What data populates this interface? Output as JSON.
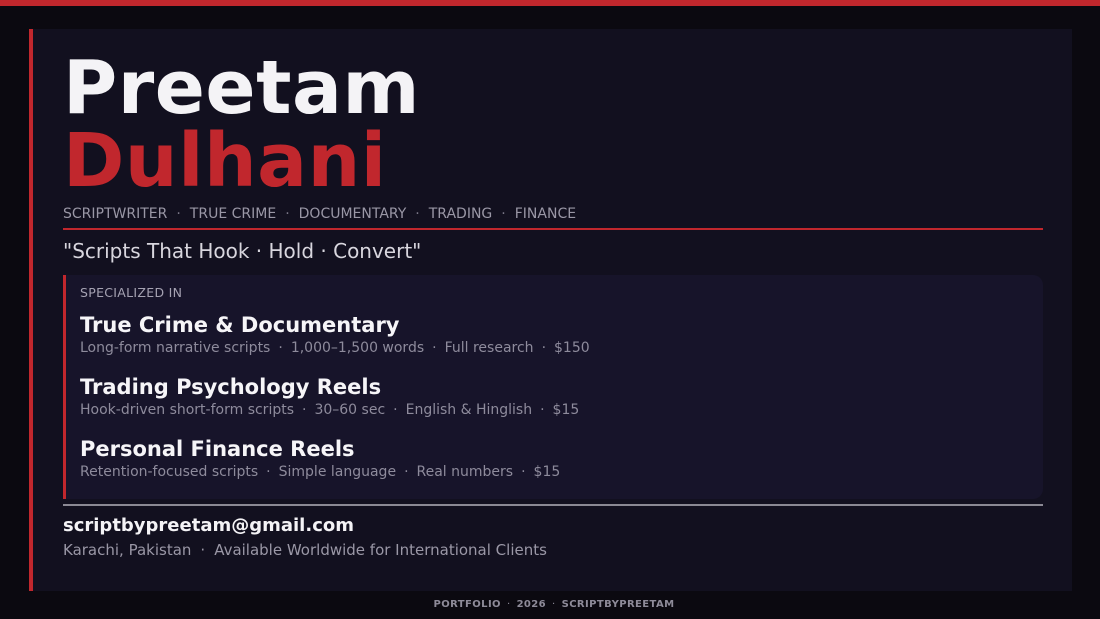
{
  "profile": {
    "first_name": "Preetam",
    "last_name": "Dulhani",
    "roles": [
      "SCRIPTWRITER",
      "TRUE CRIME",
      "DOCUMENTARY",
      "TRADING",
      "FINANCE"
    ],
    "tagline": "\"Scripts That Hook · Hold · Convert\""
  },
  "specialized": {
    "heading": "SPECIALIZED IN",
    "services": [
      {
        "title": "True Crime & Documentary",
        "details": [
          "Long-form narrative scripts",
          "1,000–1,500 words",
          "Full research",
          "$150"
        ]
      },
      {
        "title": "Trading Psychology Reels",
        "details": [
          "Hook-driven short-form scripts",
          "30–60 sec",
          "English & Hinglish",
          "$15"
        ]
      },
      {
        "title": "Personal Finance Reels",
        "details": [
          "Retention-focused scripts",
          "Simple language",
          "Real numbers",
          "$15"
        ]
      }
    ]
  },
  "contact": {
    "email": "scriptbypreetam@gmail.com",
    "location": "Karachi, Pakistan",
    "availability": "Available Worldwide for International Clients"
  },
  "footer": {
    "items": [
      "PORTFOLIO",
      "2026",
      "SCRIPTBYPREETAM"
    ]
  },
  "separator": "·",
  "colors": {
    "accent": "#c1272d",
    "background": "#0b0910",
    "card": "#12101f",
    "panel": "#17142a"
  }
}
